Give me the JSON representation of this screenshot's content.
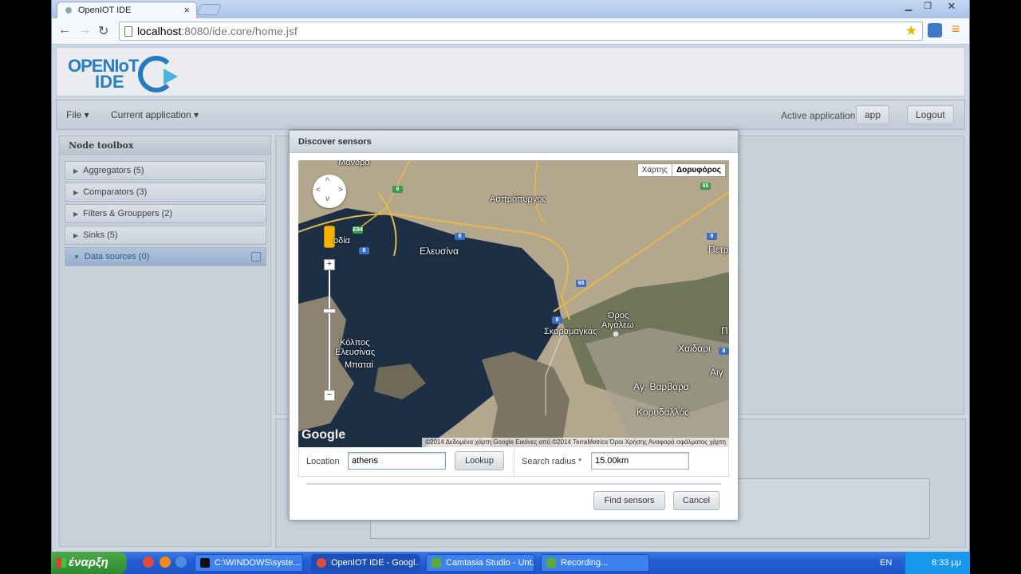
{
  "browser": {
    "tab_title": "OpenIOT IDE",
    "tab_close": "×",
    "url_host": "localhost",
    "url_rest": ":8080/ide.core/home.jsf",
    "win_min": "▁",
    "win_max": "❐",
    "win_close": "✕",
    "back": "←",
    "forward": "→",
    "reload": "↻",
    "star": "★",
    "menu": "≡"
  },
  "header": {
    "logo_line1": "OPENIoT",
    "logo_line2": "IDE"
  },
  "menubar": {
    "file": "File ▾",
    "current_application": "Current application ▾",
    "active_application_label": "Active application",
    "app_button": "app",
    "logout_button": "Logout"
  },
  "toolbox": {
    "title": "Node toolbox",
    "items": [
      {
        "label": "Aggregators (5)"
      },
      {
        "label": "Comparators (3)"
      },
      {
        "label": "Filters & Grouppers (2)"
      },
      {
        "label": "Sinks (5)"
      },
      {
        "label": "Data sources (0)"
      }
    ]
  },
  "dialog": {
    "title": "Discover sensors",
    "map_type_map": "Χάρτης",
    "map_type_satellite": "Δορυφόρος",
    "map_labels": {
      "mandra": "Μάνδρα",
      "aspropyrgos": "Ασπρόπυργος",
      "elefsina": "Ελευσίνα",
      "kolpos": "Κόλπος",
      "elefsinas": "Ελευσίνας",
      "mpatai": "Μπαταί",
      "skaramagkas": "Σκαραμαγκάς",
      "oros": "Όρος",
      "aigaleo": "Αιγάλεω",
      "chaidari": "Χαϊδάρι",
      "ag_varvara": "Αγ. Βαρβάρα",
      "korydallos": "Κορυδαλλός",
      "petr": "Πετρ",
      "aig": "Αιγ",
      "p": "Π",
      "odia": "οδία"
    },
    "shields": [
      "6",
      "65",
      "E94",
      "8",
      "8",
      "65",
      "8",
      "8",
      "8"
    ],
    "google": "Google",
    "attribution": "©2014 Δεδομένα χάρτη Google Εικόνες από ©2014 TerraMetrics   Όροι Χρήσης   Αναφορά σφάλματος χάρτη",
    "location_label": "Location",
    "location_value": "athens",
    "lookup_button": "Lookup",
    "radius_label": "Search radius *",
    "radius_value": "15.00km",
    "find_button": "Find sensors",
    "cancel_button": "Cancel"
  },
  "taskbar": {
    "start": "έναρξη",
    "tasks": [
      {
        "label": "C:\\WINDOWS\\syste..."
      },
      {
        "label": "OpenIOT IDE - Googl..."
      },
      {
        "label": "Camtasia Studio - Unt..."
      },
      {
        "label": "Recording..."
      }
    ],
    "lang": "EN",
    "clock": "8:33 μμ"
  }
}
